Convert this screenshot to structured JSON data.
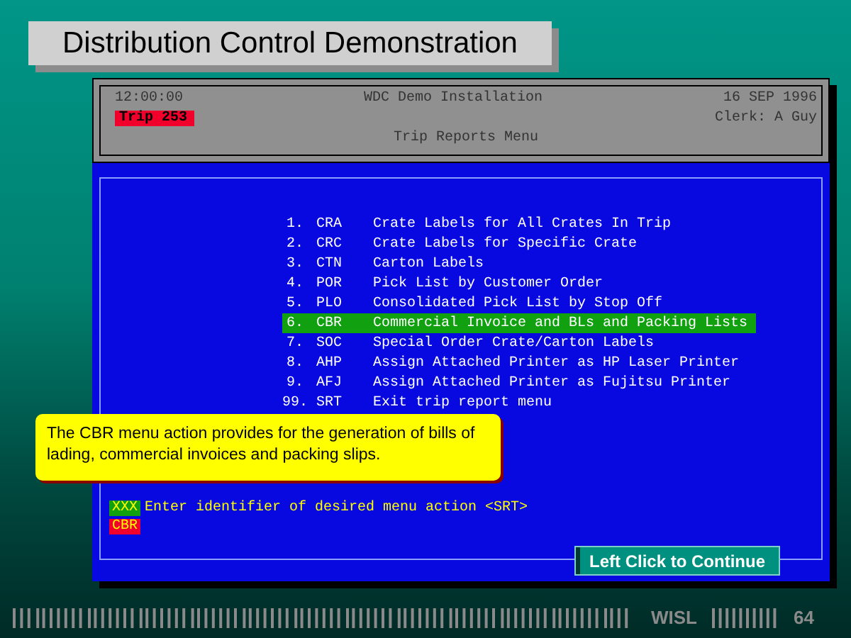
{
  "slide_title": "Distribution Control Demonstration",
  "terminal": {
    "header": {
      "time": "12:00:00",
      "installation": "WDC Demo Installation",
      "date": "16 SEP 1996",
      "trip": "Trip 253",
      "clerk": "Clerk: A Guy",
      "menu_title": "Trip Reports Menu"
    },
    "menu": [
      {
        "number": "1.",
        "code": "CRA",
        "description": "Crate Labels for All Crates In Trip",
        "selected": false
      },
      {
        "number": "2.",
        "code": "CRC",
        "description": "Crate Labels for Specific Crate",
        "selected": false
      },
      {
        "number": "3.",
        "code": "CTN",
        "description": "Carton Labels",
        "selected": false
      },
      {
        "number": "4.",
        "code": "POR",
        "description": "Pick List by Customer Order",
        "selected": false
      },
      {
        "number": "5.",
        "code": "PLO",
        "description": "Consolidated Pick List by Stop Off",
        "selected": false
      },
      {
        "number": "6.",
        "code": "CBR",
        "description": "Commercial Invoice and BLs and Packing Lists",
        "selected": true
      },
      {
        "number": "7.",
        "code": "SOC",
        "description": "Special Order Crate/Carton Labels",
        "selected": false
      },
      {
        "number": "8.",
        "code": "AHP",
        "description": "Assign Attached Printer as HP Laser Printer",
        "selected": false
      },
      {
        "number": "9.",
        "code": "AFJ",
        "description": "Assign Attached Printer as Fujitsu Printer",
        "selected": false
      },
      {
        "number": "99.",
        "code": "SRT",
        "description": "Exit trip report menu",
        "selected": false
      }
    ],
    "prompt": {
      "tag": "XXX",
      "text": "Enter identifier of desired menu action <SRT>"
    },
    "input": {
      "value": "CBR"
    }
  },
  "callout": "The CBR menu action provides for the generation of bills of lading, commercial invoices and packing slips.",
  "continue_button": "Left Click to Continue",
  "footer": {
    "label": "WISL",
    "page": "64"
  }
}
